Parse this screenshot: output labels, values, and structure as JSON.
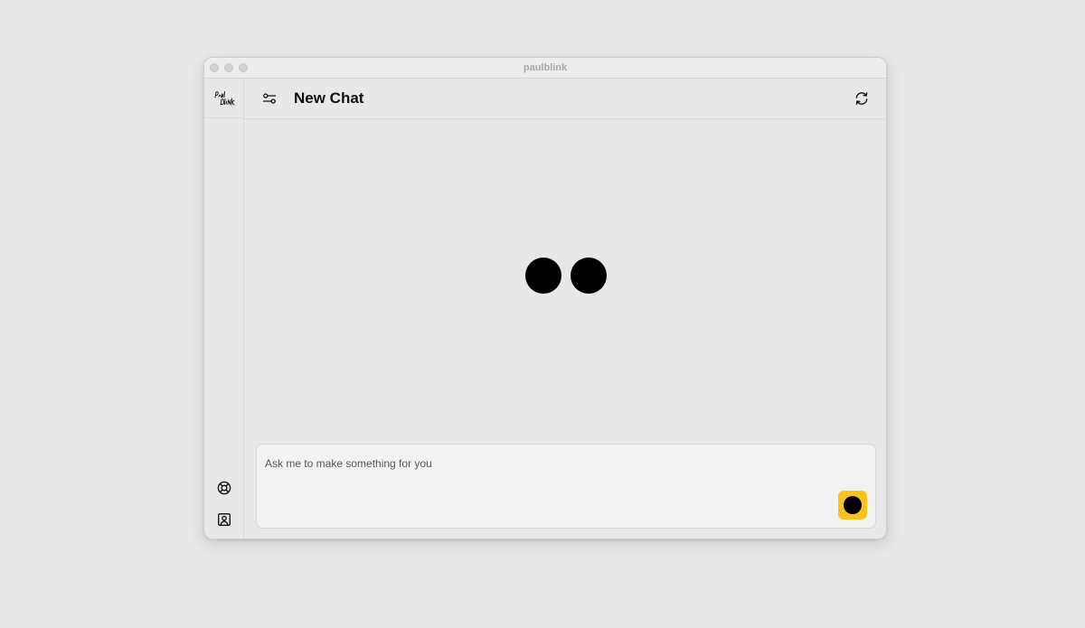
{
  "window": {
    "title": "paulblink"
  },
  "sidebar": {
    "logo_icon": "paulblink-logo-icon",
    "items": [
      {
        "icon": "lifebuoy-icon"
      },
      {
        "icon": "user-card-icon"
      }
    ]
  },
  "header": {
    "title": "New Chat",
    "settings_icon": "sliders-icon",
    "refresh_icon": "refresh-icon"
  },
  "composer": {
    "placeholder": "Ask me to make something for you",
    "value": "",
    "send_color": "#f9c31b"
  }
}
